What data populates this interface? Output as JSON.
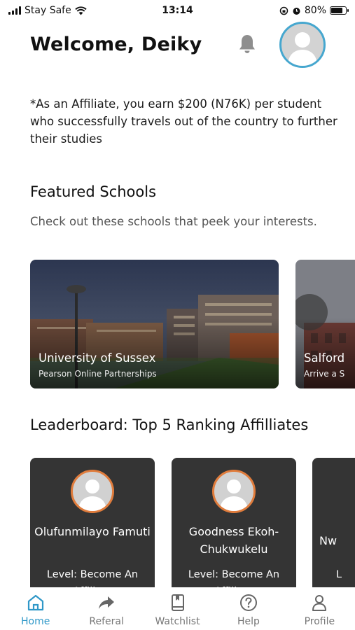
{
  "status_bar": {
    "carrier": "Stay Safe",
    "time": "13:14",
    "battery": "80%"
  },
  "header": {
    "welcome": "Welcome, Deiky"
  },
  "info_text": "*As an Affiliate, you earn $200 (N76K) per student who successfully travels out of the country to further their studies",
  "featured": {
    "title": "Featured Schools",
    "subtitle": "Check out these schools that peek your interests.",
    "schools": [
      {
        "name": "University of Sussex",
        "sub": "Pearson Online Partnerships"
      },
      {
        "name": "Salford",
        "sub": "Arrive a S"
      }
    ]
  },
  "leaderboard": {
    "title": "Leaderboard: Top 5 Ranking Affilliates",
    "items": [
      {
        "name": "Olufunmilayo Famuti",
        "level": "Level: Become An Affiliate"
      },
      {
        "name": "Goodness Ekoh-Chukwukelu",
        "level": "Level: Become An Affiliate"
      },
      {
        "name": "Nw",
        "level": "L"
      }
    ]
  },
  "nav": [
    {
      "label": "Home",
      "icon": "home-icon"
    },
    {
      "label": "Referal",
      "icon": "share-arrow-icon"
    },
    {
      "label": "Watchlist",
      "icon": "bookmark-book-icon"
    },
    {
      "label": "Help",
      "icon": "question-circle-icon"
    },
    {
      "label": "Profile",
      "icon": "person-icon"
    }
  ],
  "colors": {
    "accent": "#2f98c8",
    "avatar_ring": "#46a7cf",
    "leader_ring": "#e07c3c",
    "card_dark": "#343434"
  }
}
